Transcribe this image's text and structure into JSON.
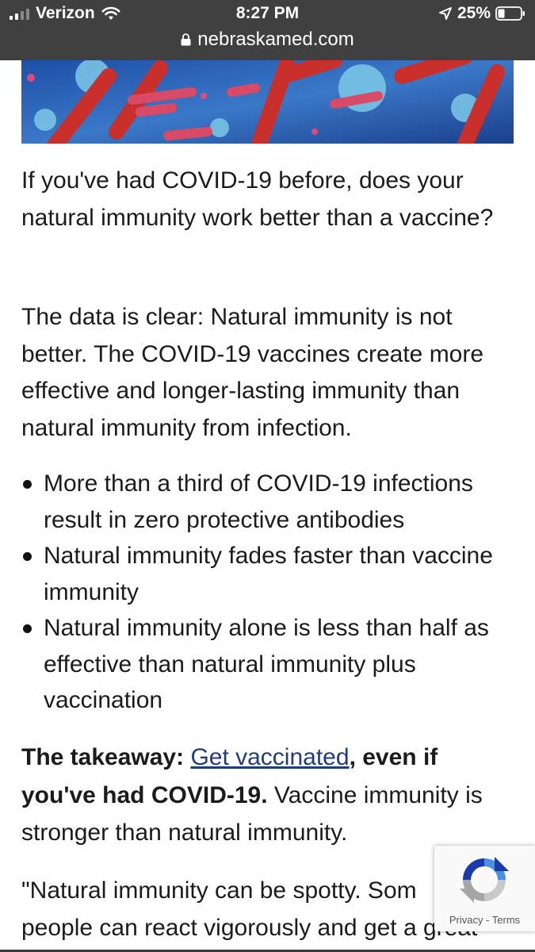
{
  "status_bar": {
    "carrier": "Verizon",
    "time": "8:27 PM",
    "battery": "25%"
  },
  "url_bar": {
    "domain": "nebraskamed.com"
  },
  "article": {
    "intro": "If you've had COVID-19 before, does your natural immunity work better than a vaccine?",
    "data_clear": "The data is clear: Natural immunity is not better. The COVID-19 vaccines create more effective and longer-lasting immunity than natural immunity from infection.",
    "bullets": [
      "More than a third of COVID-19 infections result in zero protective antibodies",
      "Natural immunity fades faster than vaccine immunity",
      "Natural immunity alone is less than half as effective than natural immunity plus vaccination"
    ],
    "takeaway_label": "The takeaway:",
    "takeaway_link": "Get vaccinated",
    "takeaway_bold_after": ", even if you've had COVID-19.",
    "takeaway_rest": " Vaccine immunity is stronger than natural immunity.",
    "quote_line1": "\"Natural immunity can be spotty. Som",
    "quote_line2": "people can react vigorously and get a great"
  },
  "recaptcha": {
    "links": "Privacy - Terms"
  }
}
